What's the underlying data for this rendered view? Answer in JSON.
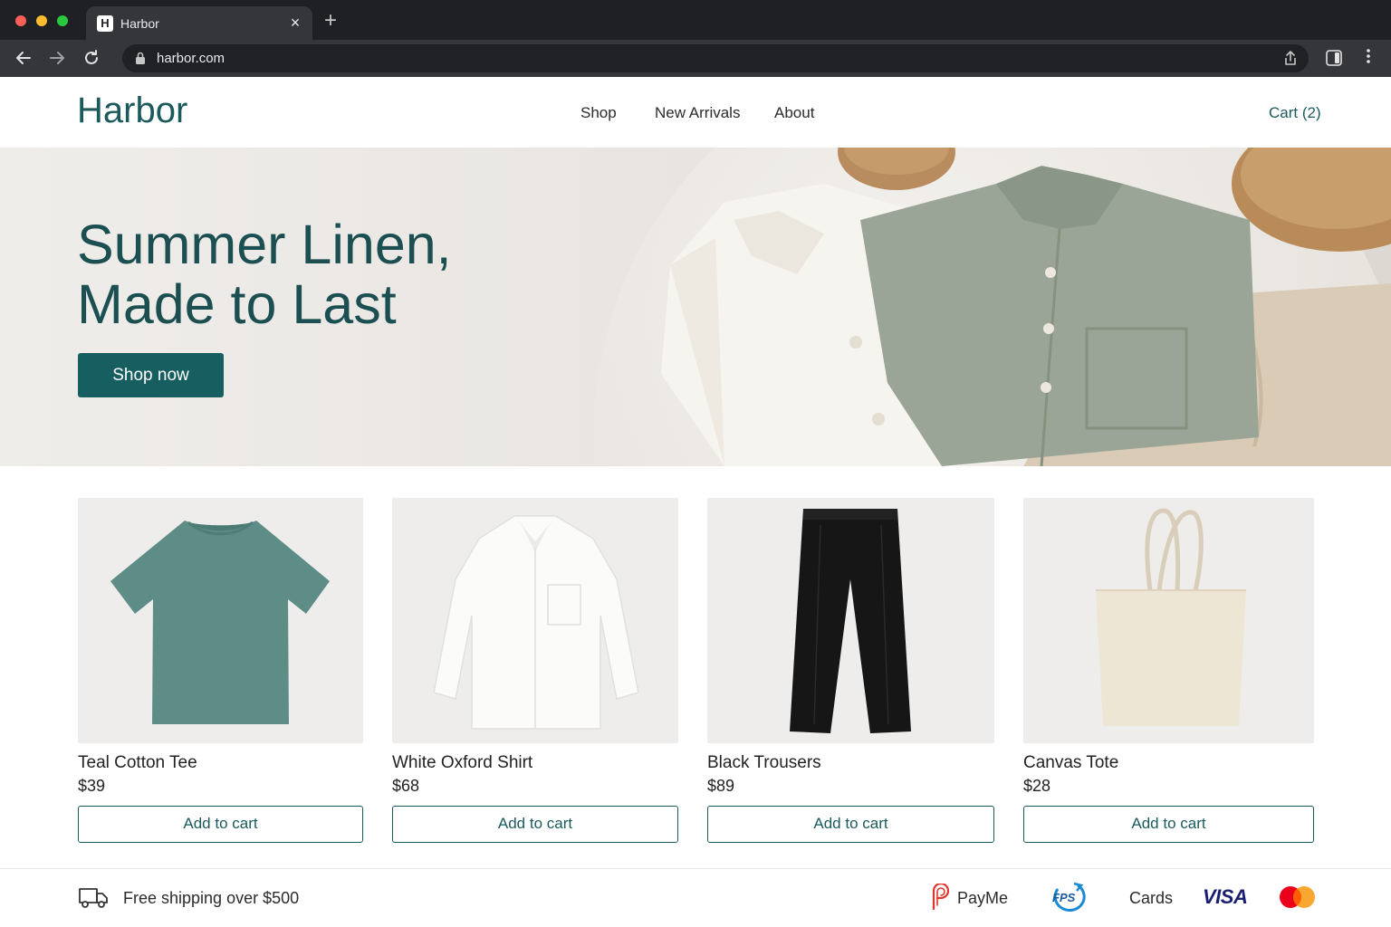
{
  "browser": {
    "tab_title": "Harbor",
    "tab_favicon": "H",
    "close_glyph": "×",
    "newtab_glyph": "+",
    "url": "harbor.com",
    "icons": [
      "back-icon",
      "forward-icon",
      "reload-icon",
      "lock-icon",
      "share-icon",
      "sidepanel-icon",
      "menu-icon"
    ]
  },
  "header": {
    "logo": "Harbor",
    "nav": [
      "Shop",
      "New Arrivals",
      "About"
    ],
    "cart": "Cart (2)"
  },
  "hero": {
    "title_line1": "Summer Linen,",
    "title_line2": "Made to Last",
    "cta": "Shop now"
  },
  "products": [
    {
      "name": "Teal Cotton Tee",
      "price": "$39",
      "cta": "Add to cart"
    },
    {
      "name": "White Oxford Shirt",
      "price": "$68",
      "cta": "Add to cart"
    },
    {
      "name": "Black Trousers",
      "price": "$89",
      "cta": "Add to cart"
    },
    {
      "name": "Canvas Tote",
      "price": "$28",
      "cta": "Add to cart"
    }
  ],
  "footer": {
    "shipping": "Free shipping over $500",
    "payments": {
      "payme": "PayMe",
      "fps": "FPS",
      "cards": "Cards",
      "visa": "VISA"
    }
  },
  "colors": {
    "brand": "#1b5a5c",
    "hero_button": "#175e60",
    "chrome_dark": "#1f2023",
    "chrome_toolbar": "#35363a"
  }
}
